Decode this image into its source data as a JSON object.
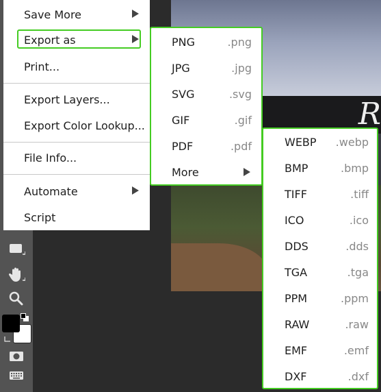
{
  "menu": {
    "items": [
      {
        "label": "Save More",
        "submenu": true
      },
      {
        "label": "Export as",
        "submenu": true,
        "highlighted": true
      },
      {
        "label": "Print..."
      },
      {
        "label": "Export Layers..."
      },
      {
        "label": "Export Color Lookup..."
      },
      {
        "label": "File Info..."
      },
      {
        "label": "Automate",
        "submenu": true
      },
      {
        "label": "Script"
      }
    ]
  },
  "export_submenu": {
    "items": [
      {
        "label": "PNG",
        "ext": ".png"
      },
      {
        "label": "JPG",
        "ext": ".jpg"
      },
      {
        "label": "SVG",
        "ext": ".svg"
      },
      {
        "label": "GIF",
        "ext": ".gif"
      },
      {
        "label": "PDF",
        "ext": ".pdf"
      },
      {
        "label": "More",
        "submenu": true
      }
    ]
  },
  "more_submenu": {
    "items": [
      {
        "label": "WEBP",
        "ext": ".webp"
      },
      {
        "label": "BMP",
        "ext": ".bmp"
      },
      {
        "label": "TIFF",
        "ext": ".tiff"
      },
      {
        "label": "ICO",
        "ext": ".ico"
      },
      {
        "label": "DDS",
        "ext": ".dds"
      },
      {
        "label": "TGA",
        "ext": ".tga"
      },
      {
        "label": "PPM",
        "ext": ".ppm"
      },
      {
        "label": "RAW",
        "ext": ".raw"
      },
      {
        "label": "EMF",
        "ext": ".emf"
      },
      {
        "label": "DXF",
        "ext": ".dxf"
      }
    ]
  },
  "canvas": {
    "partial_title": "R"
  },
  "colors": {
    "highlight": "#44cc22",
    "menu_bg": "#ffffff",
    "toolbar_bg": "#535353",
    "workspace_bg": "#2b2b2b",
    "foreground_swatch": "#000000",
    "background_swatch": "#ffffff"
  },
  "toolbar": {
    "icons": [
      "rectangle-shape-icon",
      "hand-icon",
      "zoom-icon",
      "color-swatches",
      "quick-mask-icon",
      "keyboard-icon"
    ]
  }
}
